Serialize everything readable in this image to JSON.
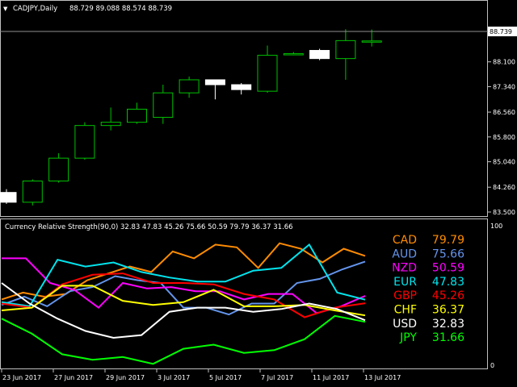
{
  "main_chart": {
    "symbol_header": "CADJPY,Daily",
    "ohlc_header": "88.729 89.088 88.574 88.739",
    "current_price": "88.739",
    "price_ticks": [
      "88.100",
      "87.340",
      "86.560",
      "85.800",
      "85.040",
      "84.260",
      "83.500"
    ],
    "colors": {
      "bull": "#00c000",
      "bear": "#ffffff",
      "grid": "#404040",
      "axis": "#c0c0c0"
    }
  },
  "chart_data": [
    {
      "type": "candlestick",
      "title": "CADJPY,Daily",
      "ylim": [
        83.45,
        89.5
      ],
      "candles": [
        {
          "o": 84.1,
          "h": 84.2,
          "l": 83.75,
          "c": 83.8
        },
        {
          "o": 83.8,
          "h": 84.5,
          "l": 83.7,
          "c": 84.45
        },
        {
          "o": 84.45,
          "h": 85.3,
          "l": 84.4,
          "c": 85.15
        },
        {
          "o": 85.15,
          "h": 86.25,
          "l": 85.1,
          "c": 86.15
        },
        {
          "o": 86.15,
          "h": 86.7,
          "l": 86.0,
          "c": 86.25
        },
        {
          "o": 86.25,
          "h": 86.85,
          "l": 86.2,
          "c": 86.65
        },
        {
          "o": 86.4,
          "h": 87.4,
          "l": 86.2,
          "c": 87.15
        },
        {
          "o": 87.15,
          "h": 87.65,
          "l": 87.0,
          "c": 87.55
        },
        {
          "o": 87.55,
          "h": 87.55,
          "l": 86.95,
          "c": 87.4
        },
        {
          "o": 87.4,
          "h": 87.45,
          "l": 87.1,
          "c": 87.25
        },
        {
          "o": 87.2,
          "h": 88.6,
          "l": 87.15,
          "c": 88.3
        },
        {
          "o": 88.35,
          "h": 88.4,
          "l": 88.3,
          "c": 88.35
        },
        {
          "o": 88.45,
          "h": 88.5,
          "l": 88.15,
          "c": 88.2
        },
        {
          "o": 88.2,
          "h": 89.1,
          "l": 87.55,
          "c": 88.75
        },
        {
          "o": 88.73,
          "h": 89.09,
          "l": 88.57,
          "c": 88.74
        }
      ]
    },
    {
      "type": "line",
      "title": "Currency Relative Strength(90,0) 32.83 47.83 45.26 75.66 50.59 79.79 36.37 31.66",
      "ylim": [
        0,
        100
      ],
      "yticks": [
        "100",
        "0"
      ],
      "categories": [
        "23 Jun 2017",
        "27 Jun 2017",
        "29 Jun 2017",
        "3 Jul 2017",
        "5 Jul 2017",
        "7 Jul 2017",
        "11 Jul 2017",
        "13 Jul 2017"
      ],
      "series": [
        {
          "name": "CAD",
          "value": "79.79",
          "color": "#ff8c00",
          "values": [
            48,
            53,
            50,
            52,
            62,
            67,
            72,
            68,
            83,
            78,
            88,
            86,
            71,
            89,
            85,
            75,
            85,
            79.79
          ]
        },
        {
          "name": "AUD",
          "value": "75.66",
          "color": "#6495ed",
          "values": [
            44,
            50,
            43,
            54,
            57,
            65,
            62,
            60,
            42,
            42,
            37,
            45,
            45,
            60,
            63,
            70,
            75.66
          ]
        },
        {
          "name": "NZD",
          "value": "50.59",
          "color": "#ff00ff",
          "values": [
            78,
            78,
            60,
            55,
            42,
            60,
            56,
            57,
            54,
            54,
            48,
            52,
            52,
            38,
            43,
            50.59
          ]
        },
        {
          "name": "EUR",
          "value": "47.83",
          "color": "#00e5ee",
          "values": [
            46,
            43,
            77,
            72,
            75,
            68,
            64,
            61,
            61,
            69,
            71,
            88,
            53,
            47.83
          ]
        },
        {
          "name": "GBP",
          "value": "45.26",
          "color": "#ff0000",
          "values": [
            45,
            42,
            59,
            66,
            67,
            60,
            60,
            59,
            52,
            48,
            35,
            42,
            45.26
          ]
        },
        {
          "name": "CHF",
          "value": "36.37",
          "color": "#ffff00",
          "values": [
            40,
            42,
            58,
            58,
            47,
            44,
            46,
            55,
            43,
            43,
            44,
            40,
            36.37
          ]
        },
        {
          "name": "USD",
          "value": "32.83",
          "color": "#ffffff",
          "values": [
            60,
            45,
            34,
            25,
            20,
            22,
            39,
            42,
            42,
            39,
            41,
            45,
            41,
            32.83
          ]
        },
        {
          "name": "JPY",
          "value": "31.66",
          "color": "#00ff00",
          "values": [
            34,
            23,
            8,
            4,
            6,
            1,
            12,
            15,
            9,
            11,
            19,
            36,
            31.66
          ]
        }
      ]
    }
  ],
  "indicator": {
    "header": "Currency Relative Strength(90,0) 32.83 47.83 45.26 75.66 50.59 79.79 36.37 31.66",
    "tick_top": "100",
    "tick_bottom": "0"
  },
  "date_axis": [
    "23 Jun 2017",
    "27 Jun 2017",
    "29 Jun 2017",
    "3 Jul 2017",
    "5 Jul 2017",
    "7 Jul 2017",
    "11 Jul 2017",
    "13 Jul 2017"
  ]
}
